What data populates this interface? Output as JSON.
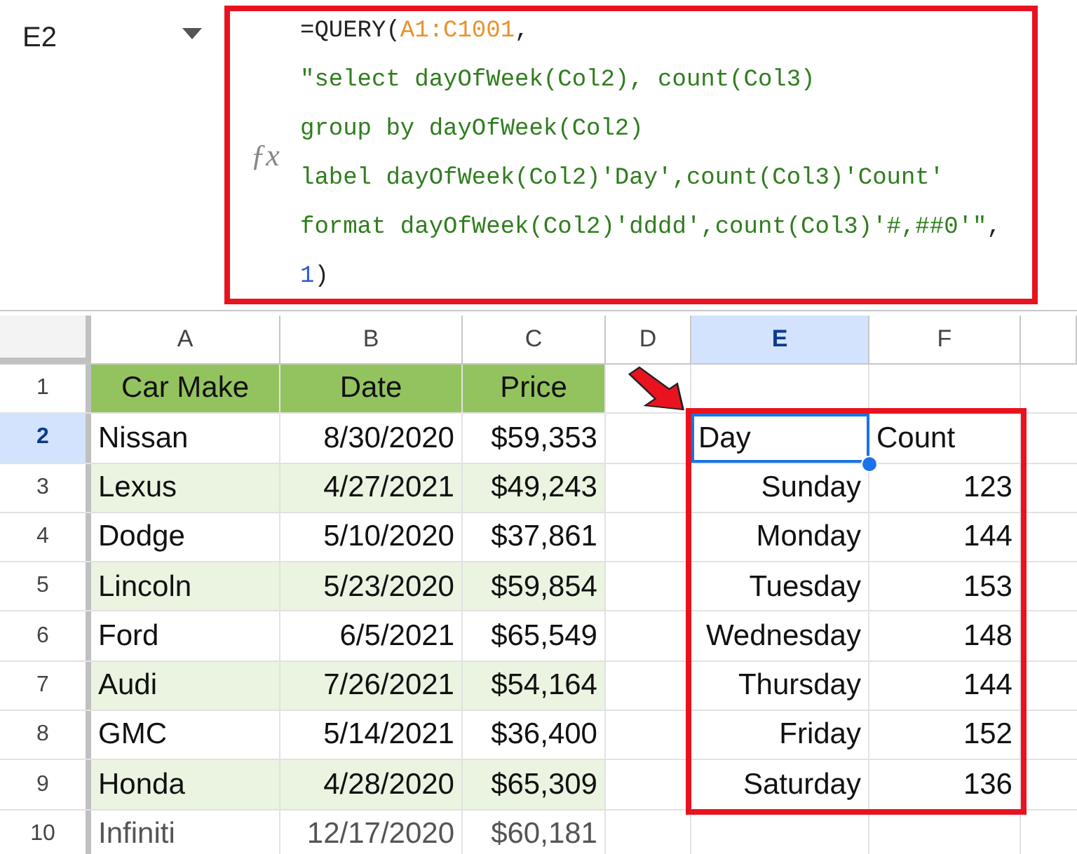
{
  "name_box": {
    "value": "E2"
  },
  "formula_bar": {
    "icon_text": "ƒx",
    "lines": [
      [
        {
          "kind": "plain",
          "text": "=QUERY("
        },
        {
          "kind": "range",
          "text": "A1:C1001"
        },
        {
          "kind": "plain",
          "text": ","
        }
      ],
      [
        {
          "kind": "string",
          "text": "\"select dayOfWeek(Col2), count(Col3)"
        }
      ],
      [
        {
          "kind": "string",
          "text": "group by dayOfWeek(Col2)"
        }
      ],
      [
        {
          "kind": "string",
          "text": "label dayOfWeek(Col2)'Day',count(Col3)'Count'"
        }
      ],
      [
        {
          "kind": "string",
          "text": "format dayOfWeek(Col2)'dddd',count(Col3)'#,##0'\""
        },
        {
          "kind": "plain",
          "text": ","
        }
      ],
      [
        {
          "kind": "number",
          "text": "1"
        },
        {
          "kind": "plain",
          "text": ")"
        }
      ]
    ]
  },
  "columns": [
    {
      "label": "A",
      "selected": false
    },
    {
      "label": "B",
      "selected": false
    },
    {
      "label": "C",
      "selected": false
    },
    {
      "label": "D",
      "selected": false
    },
    {
      "label": "E",
      "selected": true
    },
    {
      "label": "F",
      "selected": false
    }
  ],
  "rows": [
    {
      "number": "1",
      "selected": false,
      "header": true,
      "dimmed": false,
      "cells": [
        {
          "text": "Car Make"
        },
        {
          "text": "Date"
        },
        {
          "text": "Price"
        },
        null,
        null,
        null
      ]
    },
    {
      "number": "2",
      "selected": true,
      "header": false,
      "banded": false,
      "dimmed": false,
      "cells": [
        {
          "text": "Nissan",
          "numeric": false
        },
        {
          "text": "8/30/2020",
          "numeric": true
        },
        {
          "text": "$59,353",
          "numeric": true
        },
        null,
        {
          "text": "Day",
          "numeric": false
        },
        {
          "text": "Count",
          "numeric": false
        }
      ]
    },
    {
      "number": "3",
      "selected": false,
      "header": false,
      "banded": true,
      "dimmed": false,
      "cells": [
        {
          "text": "Lexus",
          "numeric": false
        },
        {
          "text": "4/27/2021",
          "numeric": true
        },
        {
          "text": "$49,243",
          "numeric": true
        },
        null,
        {
          "text": "Sunday",
          "numeric": true
        },
        {
          "text": "123",
          "numeric": true
        }
      ]
    },
    {
      "number": "4",
      "selected": false,
      "header": false,
      "banded": false,
      "dimmed": false,
      "cells": [
        {
          "text": "Dodge",
          "numeric": false
        },
        {
          "text": "5/10/2020",
          "numeric": true
        },
        {
          "text": "$37,861",
          "numeric": true
        },
        null,
        {
          "text": "Monday",
          "numeric": true
        },
        {
          "text": "144",
          "numeric": true
        }
      ]
    },
    {
      "number": "5",
      "selected": false,
      "header": false,
      "banded": true,
      "dimmed": false,
      "cells": [
        {
          "text": "Lincoln",
          "numeric": false
        },
        {
          "text": "5/23/2020",
          "numeric": true
        },
        {
          "text": "$59,854",
          "numeric": true
        },
        null,
        {
          "text": "Tuesday",
          "numeric": true
        },
        {
          "text": "153",
          "numeric": true
        }
      ]
    },
    {
      "number": "6",
      "selected": false,
      "header": false,
      "banded": false,
      "dimmed": false,
      "cells": [
        {
          "text": "Ford",
          "numeric": false
        },
        {
          "text": "6/5/2021",
          "numeric": true
        },
        {
          "text": "$65,549",
          "numeric": true
        },
        null,
        {
          "text": "Wednesday",
          "numeric": true
        },
        {
          "text": "148",
          "numeric": true
        }
      ]
    },
    {
      "number": "7",
      "selected": false,
      "header": false,
      "banded": true,
      "dimmed": false,
      "cells": [
        {
          "text": "Audi",
          "numeric": false
        },
        {
          "text": "7/26/2021",
          "numeric": true
        },
        {
          "text": "$54,164",
          "numeric": true
        },
        null,
        {
          "text": "Thursday",
          "numeric": true
        },
        {
          "text": "144",
          "numeric": true
        }
      ]
    },
    {
      "number": "8",
      "selected": false,
      "header": false,
      "banded": false,
      "dimmed": false,
      "cells": [
        {
          "text": "GMC",
          "numeric": false
        },
        {
          "text": "5/14/2021",
          "numeric": true
        },
        {
          "text": "$36,400",
          "numeric": true
        },
        null,
        {
          "text": "Friday",
          "numeric": true
        },
        {
          "text": "152",
          "numeric": true
        }
      ]
    },
    {
      "number": "9",
      "selected": false,
      "header": false,
      "banded": true,
      "dimmed": false,
      "cells": [
        {
          "text": "Honda",
          "numeric": false
        },
        {
          "text": "4/28/2020",
          "numeric": true
        },
        {
          "text": "$65,309",
          "numeric": true
        },
        null,
        {
          "text": "Saturday",
          "numeric": true
        },
        {
          "text": "136",
          "numeric": true
        }
      ]
    },
    {
      "number": "10",
      "selected": false,
      "header": false,
      "banded": false,
      "dimmed": true,
      "cells": [
        {
          "text": "Infiniti",
          "numeric": false
        },
        {
          "text": "12/17/2020",
          "numeric": true
        },
        {
          "text": "$60,181",
          "numeric": true
        },
        null,
        null,
        null
      ]
    }
  ]
}
